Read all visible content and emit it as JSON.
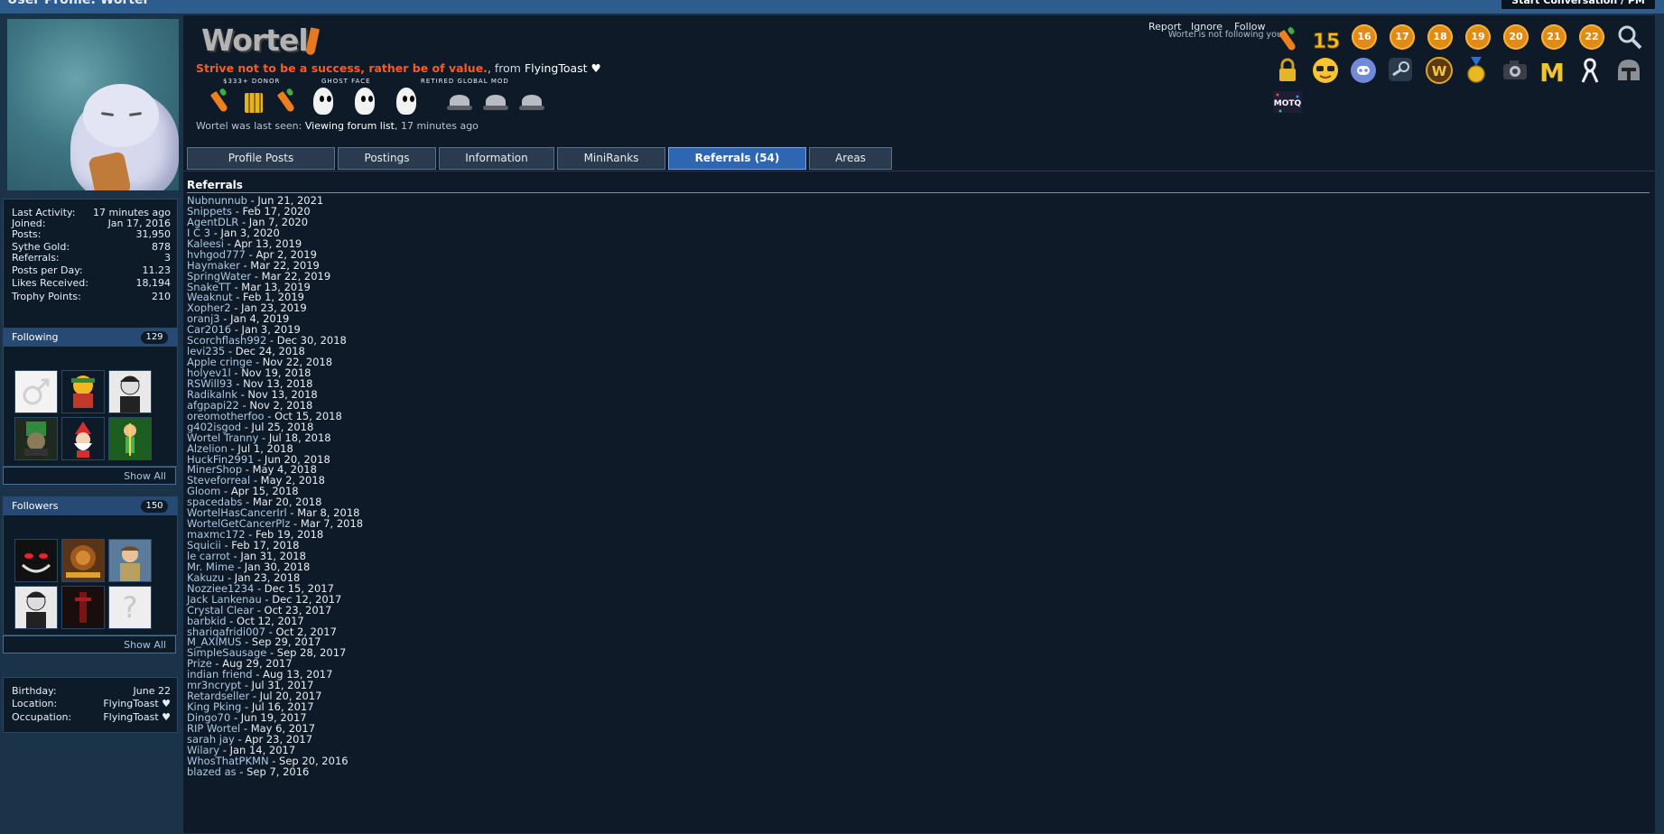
{
  "page_title": "User Profile: Wortel",
  "start_conversation_label": "Start Conversation / PM",
  "sidebar": {
    "stats": [
      {
        "label": "Last Activity:",
        "value": "17 minutes ago"
      },
      {
        "label": "Joined:",
        "value": "Jan 17, 2016"
      },
      {
        "label": "Posts:",
        "value": "31,950"
      },
      {
        "label": "Sythe Gold:",
        "value": "878"
      },
      {
        "label": "Referrals:",
        "value": "3"
      },
      {
        "label": "Posts per Day:",
        "value": "11.23"
      },
      {
        "label": "Likes Received:",
        "value": "18,194"
      },
      {
        "label": "Trophy Points:",
        "value": "210"
      }
    ],
    "following": {
      "title": "Following",
      "count": "129",
      "show_all": "Show All"
    },
    "followers": {
      "title": "Followers",
      "count": "150",
      "show_all": "Show All"
    },
    "about": [
      {
        "label": "Birthday:",
        "value": "June 22"
      },
      {
        "label": "Location:",
        "value": "FlyingToast ♥"
      },
      {
        "label": "Occupation:",
        "value": "FlyingToast ♥"
      }
    ]
  },
  "profile": {
    "logo": "Wortel",
    "status_quote": "Strive not to be a success, rather be of value.",
    "from_text": ", from ",
    "from_name": "FlyingToast ♥",
    "miniranks_labels": [
      "$333+ DONOR",
      "GHOST FACE",
      "RETIRED GLOBAL MOD"
    ],
    "last_seen_prefix": "Wortel was last seen: ",
    "last_seen_link": "Viewing forum list",
    "last_seen_suffix": ", 17 minutes ago",
    "actions": {
      "report": "Report",
      "ignore": "Ignore",
      "follow": "Follow"
    },
    "not_following": "Wortel is not following you",
    "trophy_numbers": [
      "15",
      "16",
      "17",
      "18",
      "19",
      "20",
      "21",
      "22"
    ],
    "motd_badge": "MOTQ"
  },
  "tabs": [
    {
      "label": "Profile Posts"
    },
    {
      "label": "Postings"
    },
    {
      "label": "Information"
    },
    {
      "label": "MiniRanks"
    },
    {
      "label": "Referrals (54)"
    },
    {
      "label": "Areas"
    }
  ],
  "referrals": {
    "title": "Referrals",
    "items": [
      {
        "name": "Nubnunnub",
        "date": "Jun 21, 2021"
      },
      {
        "name": "Snippets",
        "date": "Feb 17, 2020"
      },
      {
        "name": "AgentDLR",
        "date": "Jan 7, 2020"
      },
      {
        "name": "I C 3",
        "date": "Jan 3, 2020"
      },
      {
        "name": "Kaleesi",
        "date": "Apr 13, 2019"
      },
      {
        "name": "hvhgod777",
        "date": "Apr 2, 2019"
      },
      {
        "name": "Haymaker",
        "date": "Mar 22, 2019"
      },
      {
        "name": "SpringWater",
        "date": "Mar 22, 2019"
      },
      {
        "name": "SnakeTT",
        "date": "Mar 13, 2019"
      },
      {
        "name": "Weaknut",
        "date": "Feb 1, 2019"
      },
      {
        "name": "Xopher2",
        "date": "Jan 23, 2019"
      },
      {
        "name": "oranj3",
        "date": "Jan 4, 2019"
      },
      {
        "name": "Car2016",
        "date": "Jan 3, 2019"
      },
      {
        "name": "Scorchflash992",
        "date": "Dec 30, 2018"
      },
      {
        "name": "levi235",
        "date": "Dec 24, 2018"
      },
      {
        "name": "Apple cringe",
        "date": "Nov 22, 2018"
      },
      {
        "name": "holyev1l",
        "date": "Nov 19, 2018"
      },
      {
        "name": "RSWill93",
        "date": "Nov 13, 2018"
      },
      {
        "name": "Radikalnk",
        "date": "Nov 13, 2018"
      },
      {
        "name": "afgpapi22",
        "date": "Nov 2, 2018"
      },
      {
        "name": "oreomotherfoo",
        "date": "Oct 15, 2018"
      },
      {
        "name": "g402isgod",
        "date": "Jul 25, 2018"
      },
      {
        "name": "Wortel Tranny",
        "date": "Jul 18, 2018"
      },
      {
        "name": "Alzelion",
        "date": "Jul 1, 2018"
      },
      {
        "name": "HuckFin2991",
        "date": "Jun 20, 2018"
      },
      {
        "name": "MinerShop",
        "date": "May 4, 2018"
      },
      {
        "name": "Steveforreal",
        "date": "May 2, 2018"
      },
      {
        "name": "Gloom",
        "date": "Apr 15, 2018"
      },
      {
        "name": "spacedabs",
        "date": "Mar 20, 2018"
      },
      {
        "name": "WortelHasCancerIrl",
        "date": "Mar 8, 2018"
      },
      {
        "name": "WortelGetCancerPlz",
        "date": "Mar 7, 2018"
      },
      {
        "name": "maxmc172",
        "date": "Feb 19, 2018"
      },
      {
        "name": "Squicii",
        "date": "Feb 17, 2018"
      },
      {
        "name": "le carrot",
        "date": "Jan 31, 2018"
      },
      {
        "name": "Mr. Mime",
        "date": "Jan 30, 2018"
      },
      {
        "name": "Kakuzu",
        "date": "Jan 23, 2018"
      },
      {
        "name": "Nozziee1234",
        "date": "Dec 15, 2017"
      },
      {
        "name": "Jack Lankenau",
        "date": "Dec 12, 2017"
      },
      {
        "name": "Crystal Clear",
        "date": "Oct 23, 2017"
      },
      {
        "name": "barbkid",
        "date": "Oct 12, 2017"
      },
      {
        "name": "shariqafridi007",
        "date": "Oct 2, 2017"
      },
      {
        "name": "M_AXIMUS",
        "date": "Sep 29, 2017"
      },
      {
        "name": "SimpleSausage",
        "date": "Sep 28, 2017"
      },
      {
        "name": "Prize",
        "date": "Aug 29, 2017"
      },
      {
        "name": "indian friend",
        "date": "Aug 13, 2017"
      },
      {
        "name": "mr3ncrypt",
        "date": "Jul 31, 2017"
      },
      {
        "name": "Retardseller",
        "date": "Jul 20, 2017"
      },
      {
        "name": "King Pking",
        "date": "Jul 16, 2017"
      },
      {
        "name": "Dingo70",
        "date": "Jun 19, 2017"
      },
      {
        "name": "RIP Wortel",
        "date": "May 6, 2017"
      },
      {
        "name": "sarah jay",
        "date": "Apr 23, 2017"
      },
      {
        "name": "Wilary",
        "date": "Jan 14, 2017"
      },
      {
        "name": "WhosThatPKMN",
        "date": "Sep 20, 2016"
      },
      {
        "name": "blazed as",
        "date": "Sep 7, 2016"
      }
    ]
  }
}
